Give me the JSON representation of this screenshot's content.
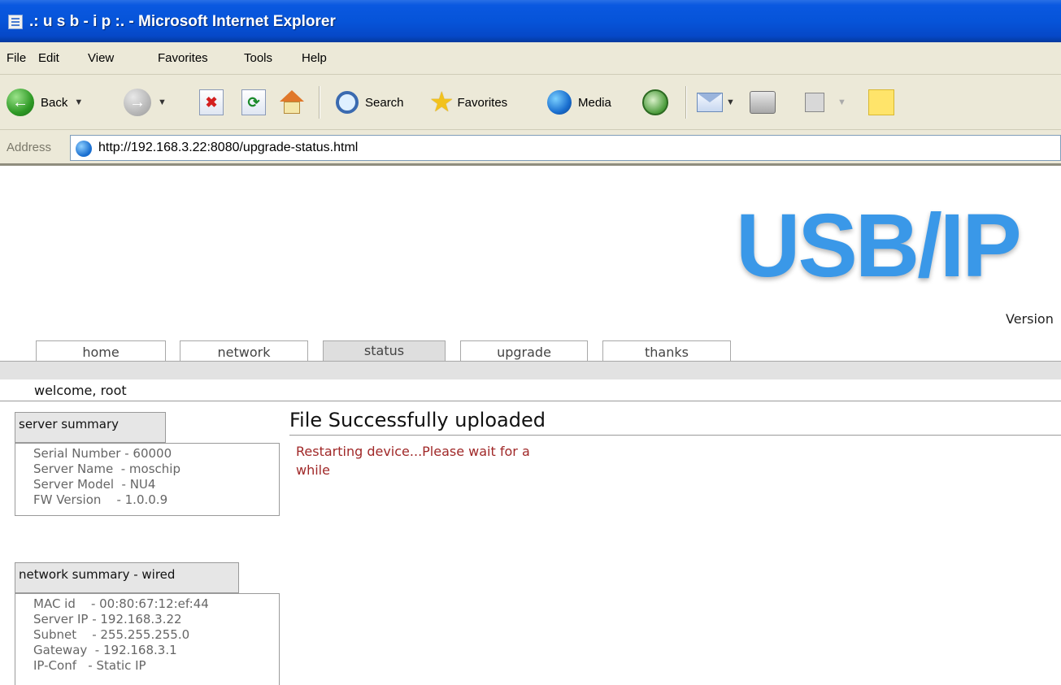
{
  "window": {
    "title": ".: u s b - i p :. - Microsoft Internet Explorer"
  },
  "menu": [
    "File",
    "Edit",
    "View",
    "Favorites",
    "Tools",
    "Help"
  ],
  "toolbar": {
    "back_label": "Back",
    "search_label": "Search",
    "favorites_label": "Favorites",
    "media_label": "Media"
  },
  "address": {
    "label": "Address",
    "url": "http://192.168.3.22:8080/upgrade-status.html"
  },
  "page": {
    "logo_text": "USB/IP",
    "version_text": "Version",
    "tabs": [
      "home",
      "network",
      "status",
      "upgrade",
      "thanks"
    ],
    "active_tab": "status",
    "welcome": "welcome, root",
    "server_summary": {
      "title": "server summary",
      "lines": [
        "Serial Number - 60000",
        "Server Name  - moschip",
        "Server Model  - NU4",
        "FW Version    - 1.0.0.9"
      ]
    },
    "network_summary": {
      "title": "network summary - wired",
      "lines": [
        "MAC id    - 00:80:67:12:ef:44",
        "Server IP - 192.168.3.22",
        "Subnet    - 255.255.255.0",
        "Gateway  - 192.168.3.1",
        "IP-Conf   - Static IP"
      ]
    },
    "heading": "File Successfully uploaded",
    "message": "Restarting device...Please wait for a while"
  }
}
